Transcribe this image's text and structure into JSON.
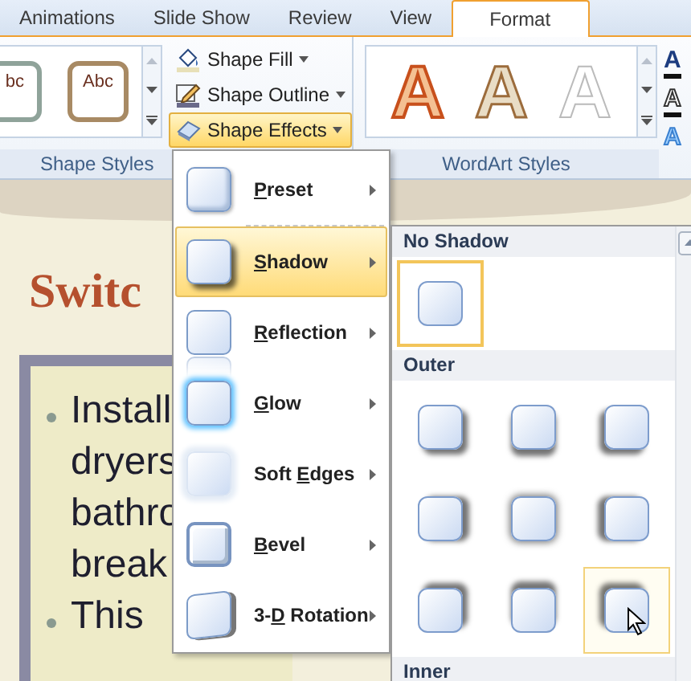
{
  "tabs": [
    {
      "label": "Animations",
      "selected": false
    },
    {
      "label": "Slide Show",
      "selected": false
    },
    {
      "label": "Review",
      "selected": false
    },
    {
      "label": "View",
      "selected": false
    },
    {
      "label": "Format",
      "selected": true
    }
  ],
  "shape_styles": {
    "label": "Shape Styles",
    "gallery": [
      {
        "text": "bc",
        "kind": "slate"
      },
      {
        "text": "Abc",
        "kind": "bronze"
      }
    ],
    "commands": [
      {
        "label": "Shape Fill",
        "kind": "fill",
        "selected": false
      },
      {
        "label": "Shape Outline",
        "kind": "outline",
        "selected": false
      },
      {
        "label": "Shape Effects",
        "kind": "effects",
        "selected": true
      }
    ]
  },
  "wordart_styles": {
    "label": "WordArt Styles",
    "gallery": [
      {
        "text": "A",
        "kind": "warm"
      },
      {
        "text": "A",
        "kind": "bronze"
      },
      {
        "text": "A",
        "kind": "white"
      }
    ],
    "tools": [
      {
        "text": "A",
        "kind": "fill"
      },
      {
        "text": "A",
        "kind": "outline"
      },
      {
        "text": "A",
        "kind": "effects"
      }
    ]
  },
  "slide": {
    "title": "Switc",
    "bullets": [
      {
        "lines": [
          "Install",
          "dryers",
          "bathro",
          "break"
        ]
      },
      {
        "lines": [
          "This"
        ]
      }
    ]
  },
  "effects_menu": {
    "items": [
      {
        "key": "P",
        "after": "reset",
        "kind": "preset",
        "selected": false
      },
      {
        "key": "S",
        "after": "hadow",
        "kind": "shadow",
        "selected": true
      },
      {
        "key": "R",
        "after": "eflection",
        "kind": "reflection",
        "selected": false
      },
      {
        "key": "G",
        "after": "low",
        "kind": "glow",
        "selected": false
      },
      {
        "before": "Soft ",
        "key": "E",
        "after": "dges",
        "kind": "soft",
        "selected": false
      },
      {
        "key": "B",
        "after": "evel",
        "kind": "bevel",
        "selected": false
      },
      {
        "before": "3-",
        "key": "D",
        "after": " Rotation",
        "kind": "rotation",
        "selected": false
      }
    ]
  },
  "shadow_gallery": {
    "sections": [
      {
        "title": "No Shadow",
        "items": [
          {
            "kind": "none",
            "selected": true,
            "hovered": false
          }
        ]
      },
      {
        "title": "Outer",
        "items": [
          {
            "kind": "se",
            "selected": false,
            "hovered": false
          },
          {
            "kind": "s",
            "selected": false,
            "hovered": false
          },
          {
            "kind": "sw",
            "selected": false,
            "hovered": false
          },
          {
            "kind": "e",
            "selected": false,
            "hovered": false
          },
          {
            "kind": "c",
            "selected": false,
            "hovered": false
          },
          {
            "kind": "w",
            "selected": false,
            "hovered": false
          },
          {
            "kind": "ne",
            "selected": false,
            "hovered": false
          },
          {
            "kind": "n",
            "selected": false,
            "hovered": false
          },
          {
            "kind": "nw",
            "selected": false,
            "hovered": true
          }
        ]
      },
      {
        "title": "Inner"
      }
    ]
  }
}
